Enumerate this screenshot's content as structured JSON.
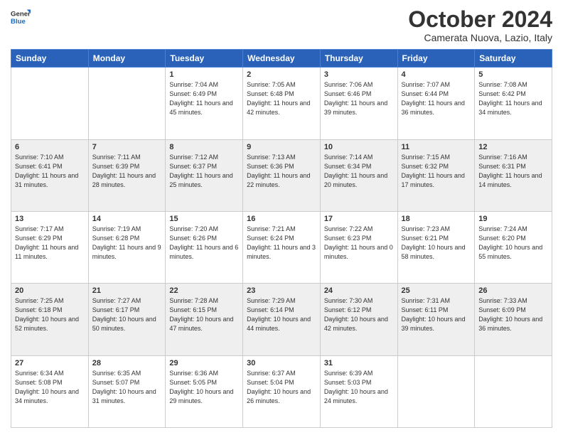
{
  "header": {
    "logo": {
      "general": "General",
      "blue": "Blue"
    },
    "title": "October 2024",
    "location": "Camerata Nuova, Lazio, Italy"
  },
  "days_of_week": [
    "Sunday",
    "Monday",
    "Tuesday",
    "Wednesday",
    "Thursday",
    "Friday",
    "Saturday"
  ],
  "weeks": [
    [
      {
        "day": "",
        "info": ""
      },
      {
        "day": "",
        "info": ""
      },
      {
        "day": "1",
        "info": "Sunrise: 7:04 AM\nSunset: 6:49 PM\nDaylight: 11 hours and 45 minutes."
      },
      {
        "day": "2",
        "info": "Sunrise: 7:05 AM\nSunset: 6:48 PM\nDaylight: 11 hours and 42 minutes."
      },
      {
        "day": "3",
        "info": "Sunrise: 7:06 AM\nSunset: 6:46 PM\nDaylight: 11 hours and 39 minutes."
      },
      {
        "day": "4",
        "info": "Sunrise: 7:07 AM\nSunset: 6:44 PM\nDaylight: 11 hours and 36 minutes."
      },
      {
        "day": "5",
        "info": "Sunrise: 7:08 AM\nSunset: 6:42 PM\nDaylight: 11 hours and 34 minutes."
      }
    ],
    [
      {
        "day": "6",
        "info": "Sunrise: 7:10 AM\nSunset: 6:41 PM\nDaylight: 11 hours and 31 minutes."
      },
      {
        "day": "7",
        "info": "Sunrise: 7:11 AM\nSunset: 6:39 PM\nDaylight: 11 hours and 28 minutes."
      },
      {
        "day": "8",
        "info": "Sunrise: 7:12 AM\nSunset: 6:37 PM\nDaylight: 11 hours and 25 minutes."
      },
      {
        "day": "9",
        "info": "Sunrise: 7:13 AM\nSunset: 6:36 PM\nDaylight: 11 hours and 22 minutes."
      },
      {
        "day": "10",
        "info": "Sunrise: 7:14 AM\nSunset: 6:34 PM\nDaylight: 11 hours and 20 minutes."
      },
      {
        "day": "11",
        "info": "Sunrise: 7:15 AM\nSunset: 6:32 PM\nDaylight: 11 hours and 17 minutes."
      },
      {
        "day": "12",
        "info": "Sunrise: 7:16 AM\nSunset: 6:31 PM\nDaylight: 11 hours and 14 minutes."
      }
    ],
    [
      {
        "day": "13",
        "info": "Sunrise: 7:17 AM\nSunset: 6:29 PM\nDaylight: 11 hours and 11 minutes."
      },
      {
        "day": "14",
        "info": "Sunrise: 7:19 AM\nSunset: 6:28 PM\nDaylight: 11 hours and 9 minutes."
      },
      {
        "day": "15",
        "info": "Sunrise: 7:20 AM\nSunset: 6:26 PM\nDaylight: 11 hours and 6 minutes."
      },
      {
        "day": "16",
        "info": "Sunrise: 7:21 AM\nSunset: 6:24 PM\nDaylight: 11 hours and 3 minutes."
      },
      {
        "day": "17",
        "info": "Sunrise: 7:22 AM\nSunset: 6:23 PM\nDaylight: 11 hours and 0 minutes."
      },
      {
        "day": "18",
        "info": "Sunrise: 7:23 AM\nSunset: 6:21 PM\nDaylight: 10 hours and 58 minutes."
      },
      {
        "day": "19",
        "info": "Sunrise: 7:24 AM\nSunset: 6:20 PM\nDaylight: 10 hours and 55 minutes."
      }
    ],
    [
      {
        "day": "20",
        "info": "Sunrise: 7:25 AM\nSunset: 6:18 PM\nDaylight: 10 hours and 52 minutes."
      },
      {
        "day": "21",
        "info": "Sunrise: 7:27 AM\nSunset: 6:17 PM\nDaylight: 10 hours and 50 minutes."
      },
      {
        "day": "22",
        "info": "Sunrise: 7:28 AM\nSunset: 6:15 PM\nDaylight: 10 hours and 47 minutes."
      },
      {
        "day": "23",
        "info": "Sunrise: 7:29 AM\nSunset: 6:14 PM\nDaylight: 10 hours and 44 minutes."
      },
      {
        "day": "24",
        "info": "Sunrise: 7:30 AM\nSunset: 6:12 PM\nDaylight: 10 hours and 42 minutes."
      },
      {
        "day": "25",
        "info": "Sunrise: 7:31 AM\nSunset: 6:11 PM\nDaylight: 10 hours and 39 minutes."
      },
      {
        "day": "26",
        "info": "Sunrise: 7:33 AM\nSunset: 6:09 PM\nDaylight: 10 hours and 36 minutes."
      }
    ],
    [
      {
        "day": "27",
        "info": "Sunrise: 6:34 AM\nSunset: 5:08 PM\nDaylight: 10 hours and 34 minutes."
      },
      {
        "day": "28",
        "info": "Sunrise: 6:35 AM\nSunset: 5:07 PM\nDaylight: 10 hours and 31 minutes."
      },
      {
        "day": "29",
        "info": "Sunrise: 6:36 AM\nSunset: 5:05 PM\nDaylight: 10 hours and 29 minutes."
      },
      {
        "day": "30",
        "info": "Sunrise: 6:37 AM\nSunset: 5:04 PM\nDaylight: 10 hours and 26 minutes."
      },
      {
        "day": "31",
        "info": "Sunrise: 6:39 AM\nSunset: 5:03 PM\nDaylight: 10 hours and 24 minutes."
      },
      {
        "day": "",
        "info": ""
      },
      {
        "day": "",
        "info": ""
      }
    ]
  ]
}
